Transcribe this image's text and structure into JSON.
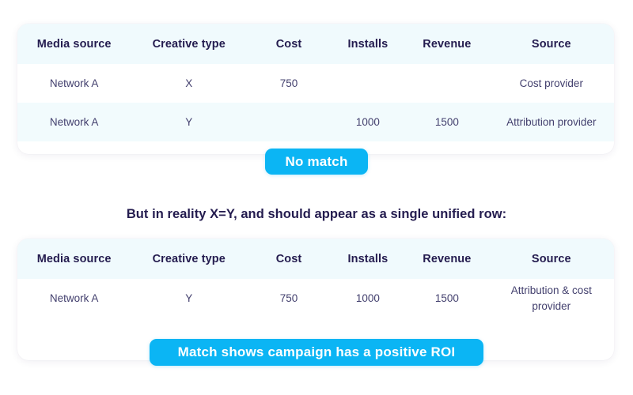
{
  "tables": {
    "columns": [
      "Media source",
      "Creative type",
      "Cost",
      "Installs",
      "Revenue",
      "Source"
    ],
    "unmatched": {
      "rows": [
        {
          "media_source": "Network A",
          "creative_type": "X",
          "cost": "750",
          "installs": "",
          "revenue": "",
          "source": "Cost provider"
        },
        {
          "media_source": "Network A",
          "creative_type": "Y",
          "cost": "",
          "installs": "1000",
          "revenue": "1500",
          "source": "Attribution provider"
        }
      ]
    },
    "unified": {
      "rows": [
        {
          "media_source": "Network A",
          "creative_type": "Y",
          "cost": "750",
          "installs": "1000",
          "revenue": "1500",
          "source": "Attribution & cost provider"
        }
      ]
    }
  },
  "badges": {
    "no_match": "No match",
    "match_roi": "Match shows campaign has a positive ROI"
  },
  "caption": "But in reality X=Y, and should appear as a single unified row:",
  "colors": {
    "accent": "#0bb5f4",
    "header_text": "#241c4f",
    "body_text": "#43406e",
    "header_bg": "#f0fafd",
    "row_alt_bg": "#f2fbfd",
    "card_bg": "#ffffff",
    "page_bg": "#ffffff"
  }
}
